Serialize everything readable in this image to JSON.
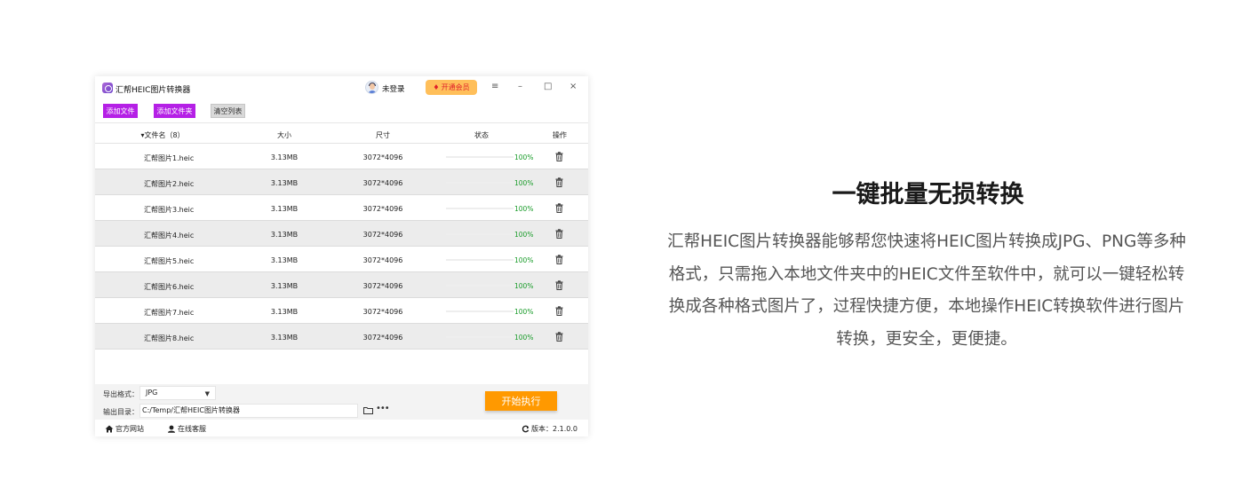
{
  "window": {
    "title": "汇帮HEIC图片转换器",
    "user_label": "未登录",
    "vip_label": "开通会员",
    "controls": {
      "menu": "≡",
      "minimize": "–",
      "maximize": "□",
      "close": "×"
    }
  },
  "toolbar": {
    "add_file": "添加文件",
    "add_folder": "添加文件夹",
    "clear_list": "清空列表"
  },
  "table": {
    "headers": {
      "name": "▾文件名（8）",
      "size": "大小",
      "dimensions": "尺寸",
      "status": "状态",
      "action": "操作"
    },
    "rows": [
      {
        "name": "汇帮图片1.heic",
        "size": "3.13MB",
        "dimensions": "3072*4096",
        "progress": 100,
        "status_text": "100%"
      },
      {
        "name": "汇帮图片2.heic",
        "size": "3.13MB",
        "dimensions": "3072*4096",
        "progress": 100,
        "status_text": "100%"
      },
      {
        "name": "汇帮图片3.heic",
        "size": "3.13MB",
        "dimensions": "3072*4096",
        "progress": 100,
        "status_text": "100%"
      },
      {
        "name": "汇帮图片4.heic",
        "size": "3.13MB",
        "dimensions": "3072*4096",
        "progress": 100,
        "status_text": "100%"
      },
      {
        "name": "汇帮图片5.heic",
        "size": "3.13MB",
        "dimensions": "3072*4096",
        "progress": 100,
        "status_text": "100%"
      },
      {
        "name": "汇帮图片6.heic",
        "size": "3.13MB",
        "dimensions": "3072*4096",
        "progress": 100,
        "status_text": "100%"
      },
      {
        "name": "汇帮图片7.heic",
        "size": "3.13MB",
        "dimensions": "3072*4096",
        "progress": 100,
        "status_text": "100%"
      },
      {
        "name": "汇帮图片8.heic",
        "size": "3.13MB",
        "dimensions": "3072*4096",
        "progress": 100,
        "status_text": "100%"
      }
    ]
  },
  "output": {
    "format_label": "导出格式：",
    "format_value": "JPG",
    "dir_label": "输出目录：",
    "dir_value": "C:/Temp/汇帮HEIC图片转换器",
    "start_label": "开始执行"
  },
  "footer": {
    "website": "官方网站",
    "support": "在线客服",
    "version": "版本：2.1.0.0"
  },
  "promo": {
    "headline": "一键批量无损转换",
    "description": "汇帮HEIC图片转换器能够帮您快速将HEIC图片转换成JPG、PNG等多种格式，只需拖入本地文件夹中的HEIC文件至软件中，就可以一键轻松转换成各种格式图片了，过程快捷方便，本地操作HEIC转换软件进行图片转换，更安全，更便捷。"
  },
  "colors": {
    "purple_button": "#b520e6",
    "progress": "#e0306a",
    "percent_text": "#1a9c2a",
    "start_button": "#ff9900",
    "vip_button": "#ffbf5a"
  }
}
